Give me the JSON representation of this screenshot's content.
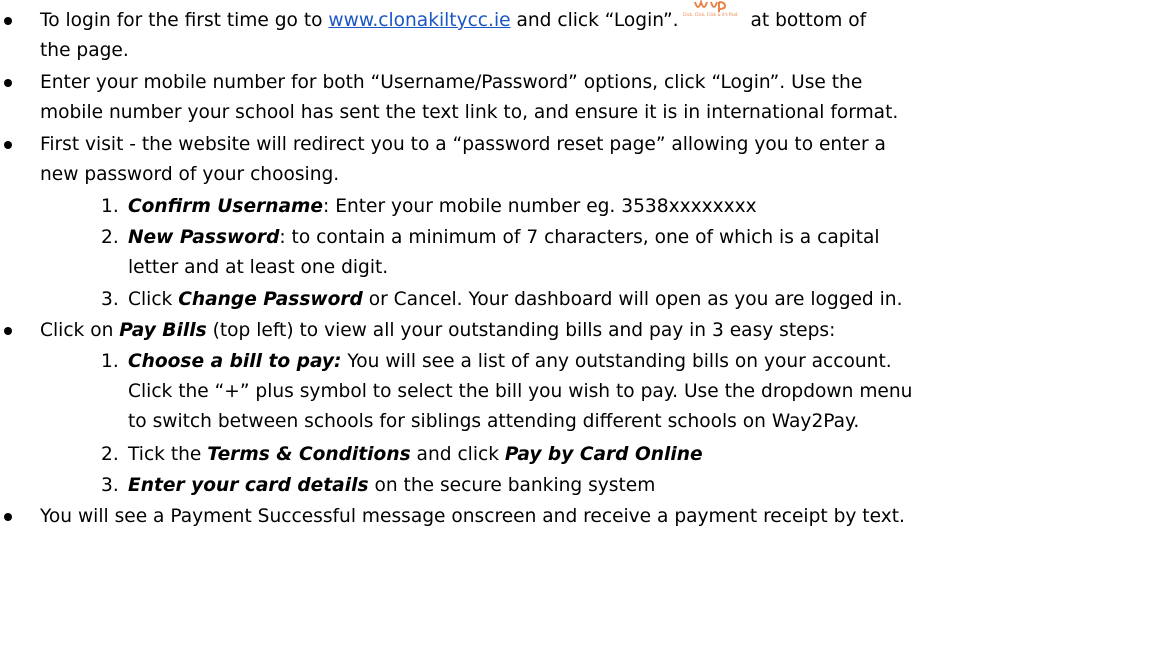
{
  "instructions": {
    "b1_l1_a": "To login for the first time go to ",
    "b1_link": "www.clonakiltycc.ie",
    "b1_l1_b": " and click “Login”.",
    "b1_l1_c": " at bottom of",
    "b1_l2": "the page.",
    "logo_tagline": "Click, Click, Click & it's Paid",
    "logo_color": "#e8834a",
    "link_color": "#1a56c4",
    "b2_l1": "Enter your mobile number for both “Username/Password” options, click “Login”. Use the",
    "b2_l2": "mobile number your school has sent the text link to, and ensure it is in international format.",
    "b3_l1": "First visit - the website will redirect you to a “password reset page” allowing you to enter a",
    "b3_l2": "new password of your choosing.",
    "s1": [
      {
        "num": "1.",
        "em": "Confirm Username",
        "l1": ": Enter your mobile number eg. 3538xxxxxxxx"
      },
      {
        "num": "2.",
        "em": "New Password",
        "l1": ": to contain a minimum of 7 characters, one of which is a capital",
        "l2": "letter and at least one digit."
      },
      {
        "num": "3.",
        "pre": "Click ",
        "em": "Change Password",
        "l1": " or Cancel.  Your dashboard will open as you are logged in."
      }
    ],
    "b4_pre": "Click on ",
    "b4_em": "Pay Bills",
    "b4_post": " (top left) to view all your outstanding bills and pay in 3 easy steps:",
    "s2": [
      {
        "num": "1.",
        "em": "Choose a bill to pay:",
        "l1": " You will see a list of any outstanding bills on your account.",
        "l2": "Click the “+” plus symbol to select the bill you wish to pay. Use the dropdown menu",
        "l3": "to switch between schools for siblings attending different schools on Way2Pay."
      },
      {
        "num": "2.",
        "pre": "Tick the ",
        "em": "Terms & Conditions",
        "mid": " and click ",
        "em2": "Pay by Card Online"
      },
      {
        "num": "3.",
        "em": "Enter your card details",
        "l1": " on the secure banking system"
      }
    ],
    "b5": "You will see a Payment Successful message onscreen and receive a payment receipt by text."
  }
}
